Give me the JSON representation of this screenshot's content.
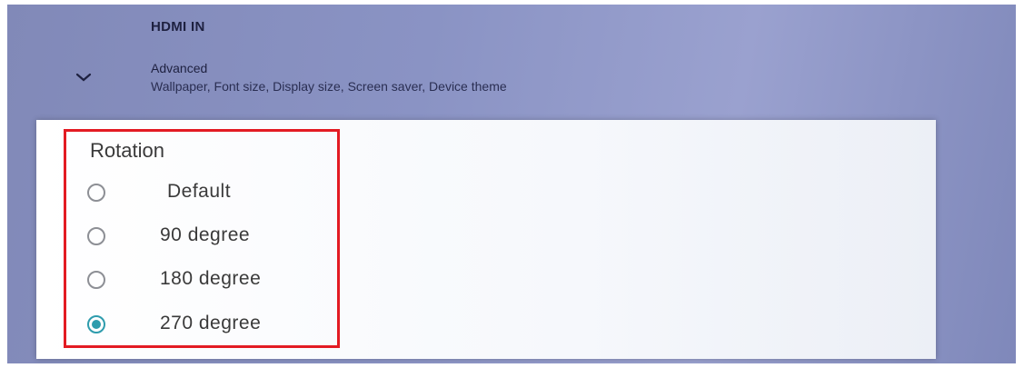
{
  "header": {
    "setting_title": "HDMI IN",
    "advanced": {
      "icon": "chevron-down-icon",
      "title": "Advanced",
      "subtitle": "Wallpaper, Font size, Display size, Screen saver, Device theme"
    }
  },
  "dialog": {
    "title": "Rotation",
    "options": [
      {
        "label": "Default",
        "selected": false
      },
      {
        "label": "90 degree",
        "selected": false
      },
      {
        "label": "180 degree",
        "selected": false
      },
      {
        "label": "270 degree",
        "selected": true
      }
    ]
  },
  "colors": {
    "accent": "#2e9cad",
    "highlight_box": "#e31b23",
    "background": "#8a93c4"
  }
}
